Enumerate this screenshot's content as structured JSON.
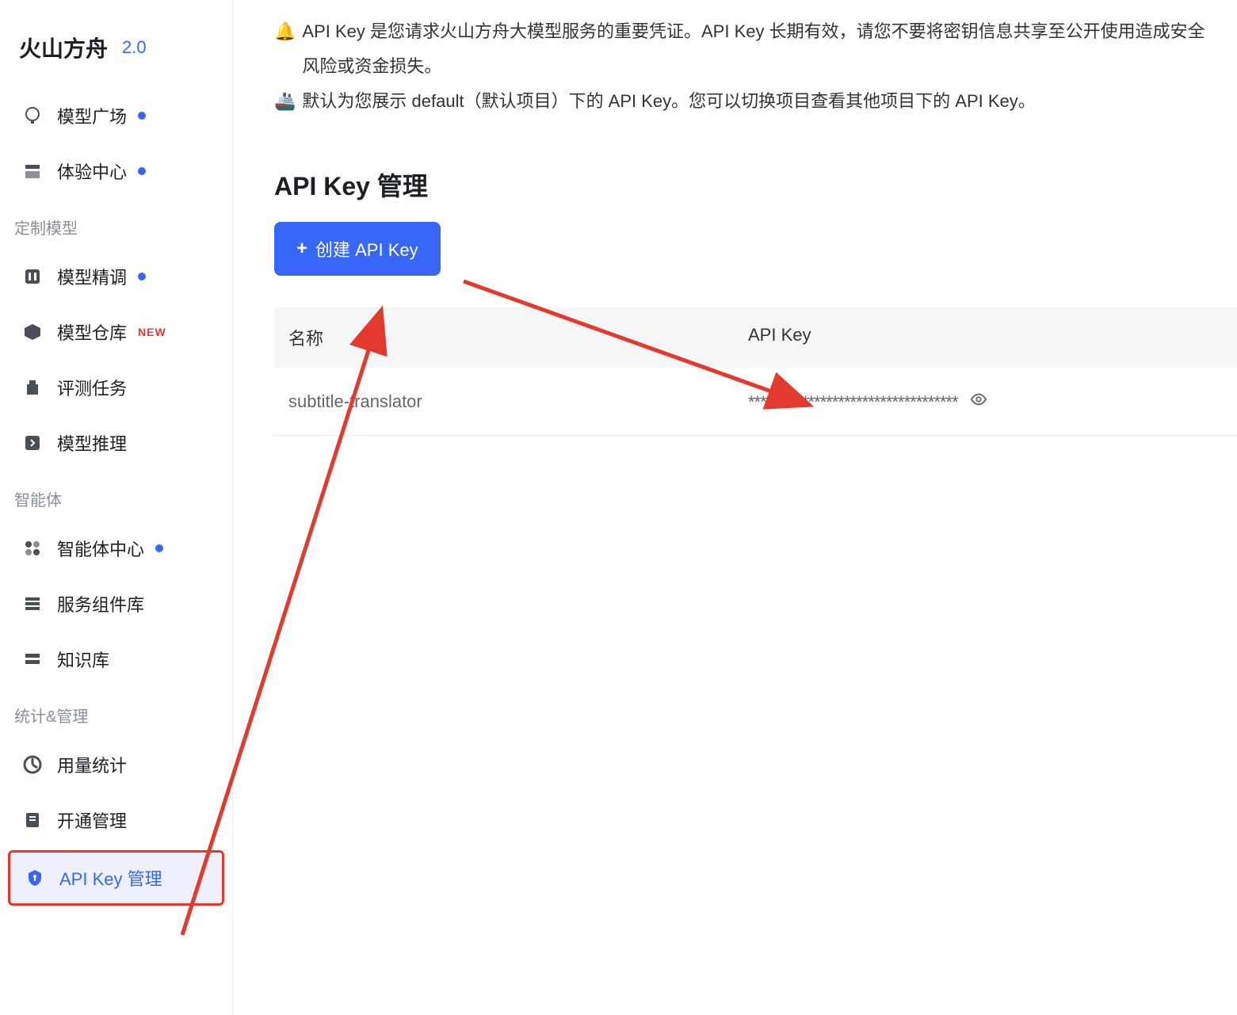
{
  "brand": {
    "title": "火山方舟",
    "version": "2.0"
  },
  "sidebar": {
    "items": [
      {
        "label": "模型广场",
        "icon": "lightbulb",
        "dot": true
      },
      {
        "label": "体验中心",
        "icon": "playground",
        "dot": true
      }
    ],
    "section_custom": "定制模型",
    "custom_items": [
      {
        "label": "模型精调",
        "icon": "finetune",
        "dot": true
      },
      {
        "label": "模型仓库",
        "icon": "warehouse",
        "badge": "NEW"
      },
      {
        "label": "评测任务",
        "icon": "evaluation"
      },
      {
        "label": "模型推理",
        "icon": "inference"
      }
    ],
    "section_agent": "智能体",
    "agent_items": [
      {
        "label": "智能体中心",
        "icon": "agent",
        "dot": true
      },
      {
        "label": "服务组件库",
        "icon": "components"
      },
      {
        "label": "知识库",
        "icon": "knowledge"
      }
    ],
    "section_stats": "统计&管理",
    "stats_items": [
      {
        "label": "用量统计",
        "icon": "usage"
      },
      {
        "label": "开通管理",
        "icon": "activation"
      },
      {
        "label": "API Key 管理",
        "icon": "apikey",
        "active": true
      }
    ]
  },
  "banner": {
    "line1": "API Key 是您请求火山方舟大模型服务的重要凭证。API Key 长期有效，请您不要将密钥信息共享至公开使用造成安全风险或资金损失。",
    "line2": "默认为您展示 default（默认项目）下的 API Key。您可以切换项目查看其他项目下的 API Key。"
  },
  "page_title": "API Key 管理",
  "create_button": "创建 API Key",
  "table": {
    "col_name": "名称",
    "col_key": "API Key",
    "rows": [
      {
        "name": "subtitle-translator",
        "key": "***********************************"
      }
    ]
  }
}
